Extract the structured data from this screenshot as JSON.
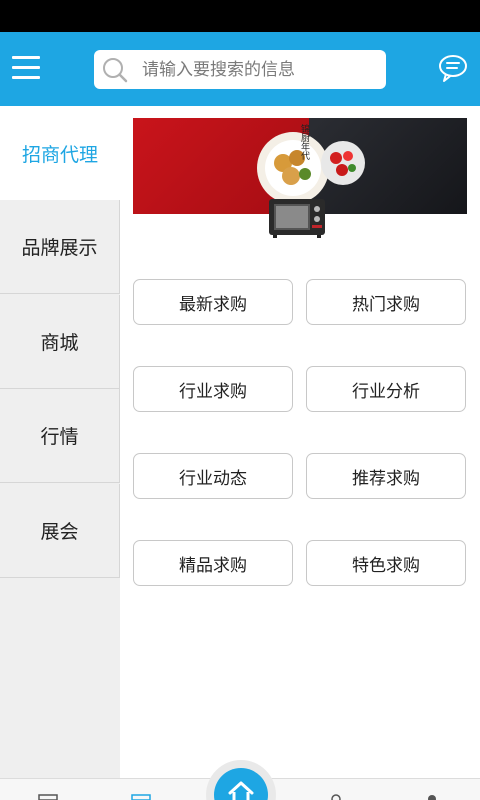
{
  "search": {
    "placeholder": "请输入要搜索的信息"
  },
  "sidebar": {
    "items": [
      {
        "label": "招商代理",
        "active": true
      },
      {
        "label": "品牌展示"
      },
      {
        "label": "商城"
      },
      {
        "label": "行情"
      },
      {
        "label": "展会"
      }
    ]
  },
  "banner": {
    "brand_text": "锦厨年代"
  },
  "categories": [
    "最新求购",
    "热门求购",
    "行业求购",
    "行业分析",
    "行业动态",
    "推荐求购",
    "精品求购",
    "特色求购"
  ],
  "colors": {
    "accent": "#1EA6E3",
    "sidebar_bg": "#EFEFEF",
    "banner_red": "#C9141B"
  }
}
